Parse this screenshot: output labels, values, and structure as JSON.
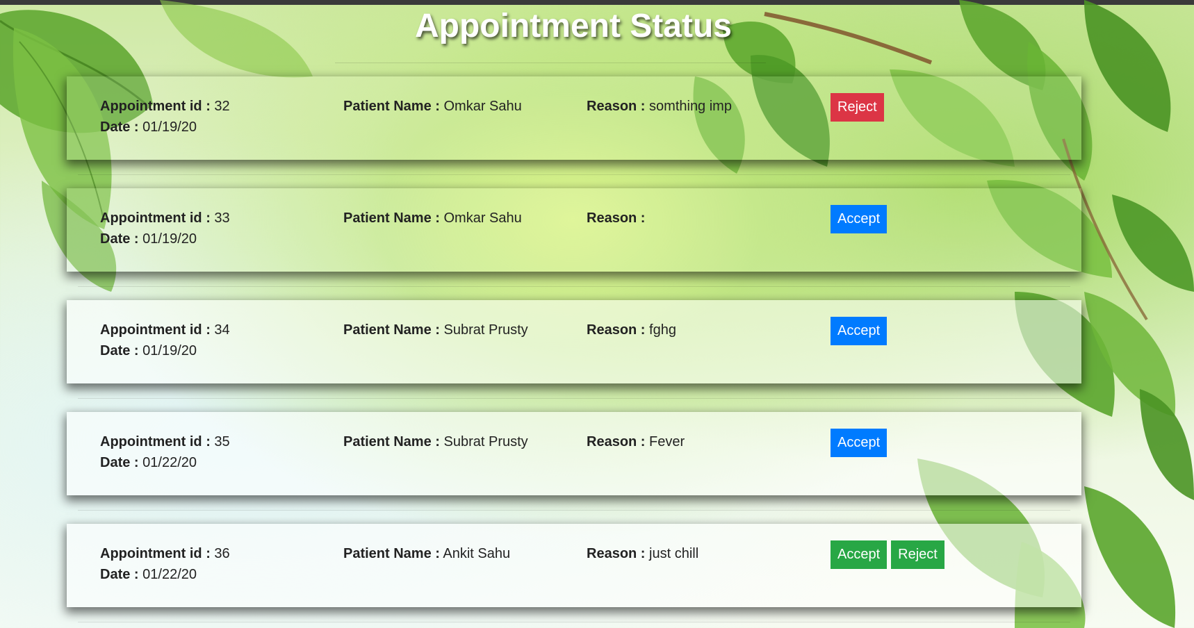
{
  "page": {
    "title": "Appointment Status"
  },
  "labels": {
    "appointment_id": "Appointment id :",
    "date": "Date :",
    "patient_name": "Patient Name :",
    "reason": "Reason :"
  },
  "colors": {
    "reject": "#dc3545",
    "accept_primary": "#007bff",
    "accept_success": "#28a745"
  },
  "appointments": [
    {
      "id": "32",
      "date": "01/19/20",
      "patient_name": "Omkar Sahu",
      "reason": "somthing imp",
      "buttons": [
        {
          "label": "Reject",
          "variant": "reject"
        }
      ]
    },
    {
      "id": "33",
      "date": "01/19/20",
      "patient_name": "Omkar Sahu",
      "reason": "",
      "buttons": [
        {
          "label": "Accept",
          "variant": "accept_primary"
        }
      ]
    },
    {
      "id": "34",
      "date": "01/19/20",
      "patient_name": "Subrat Prusty",
      "reason": "fghg",
      "buttons": [
        {
          "label": "Accept",
          "variant": "accept_primary"
        }
      ]
    },
    {
      "id": "35",
      "date": "01/22/20",
      "patient_name": "Subrat Prusty",
      "reason": "Fever",
      "buttons": [
        {
          "label": "Accept",
          "variant": "accept_primary"
        }
      ]
    },
    {
      "id": "36",
      "date": "01/22/20",
      "patient_name": "Ankit Sahu",
      "reason": "just chill",
      "buttons": [
        {
          "label": "Accept",
          "variant": "accept_success"
        },
        {
          "label": "Reject",
          "variant": "accept_success"
        }
      ]
    }
  ]
}
